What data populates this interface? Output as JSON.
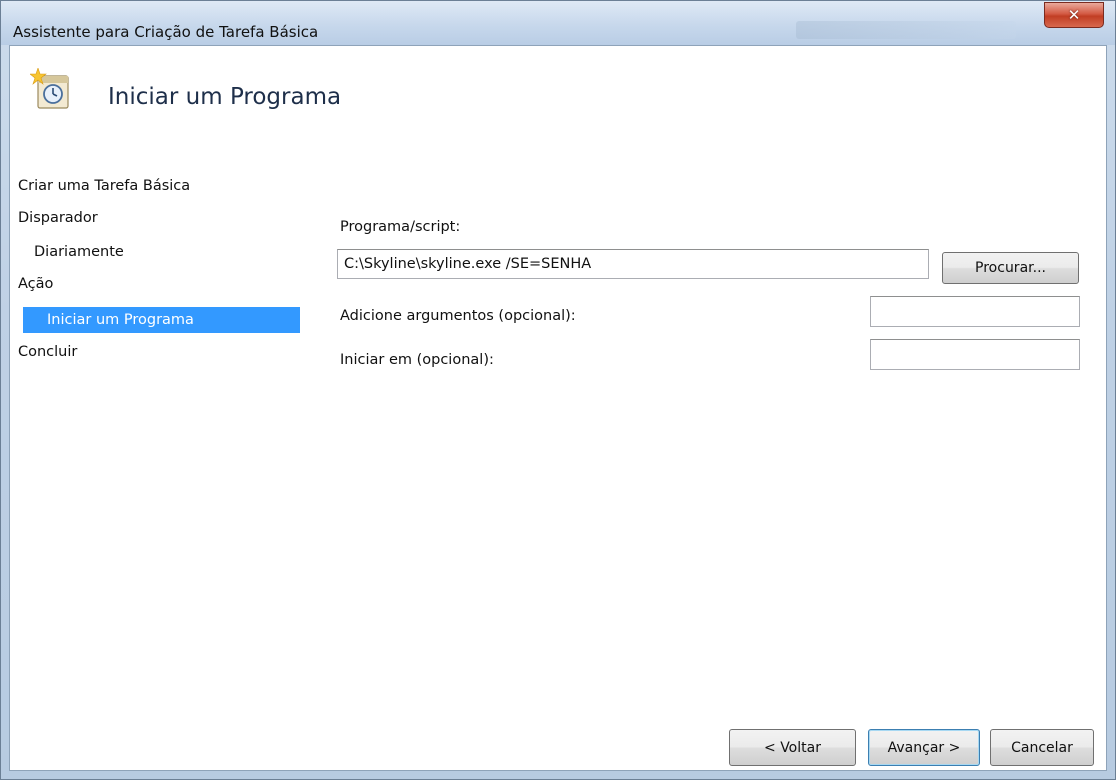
{
  "window": {
    "title": "Assistente para Criação de Tarefa Básica",
    "close_label": "✕"
  },
  "header": {
    "icon": "scheduled-task-icon",
    "title": "Iniciar um Programa"
  },
  "nav": {
    "items": [
      {
        "label": "Criar uma Tarefa Básica",
        "selected": false
      },
      {
        "label": "Disparador",
        "selected": false
      },
      {
        "label": "Diariamente",
        "selected": false
      },
      {
        "label": "Ação",
        "selected": false
      },
      {
        "label": "Iniciar um Programa",
        "selected": true
      },
      {
        "label": "Concluir",
        "selected": false
      }
    ]
  },
  "form": {
    "program_label": "Programa/script:",
    "program_value": "C:\\Skyline\\skyline.exe /SE=SENHA",
    "browse_label": "Procurar...",
    "args_label": "Adicione argumentos (opcional):",
    "args_value": "",
    "start_in_label": "Iniciar em (opcional):",
    "start_in_value": ""
  },
  "footer": {
    "back_label": "< Voltar",
    "next_label": "Avançar >",
    "cancel_label": "Cancelar"
  },
  "colors": {
    "selection": "#3399ff",
    "close_button": "#c13e24"
  }
}
